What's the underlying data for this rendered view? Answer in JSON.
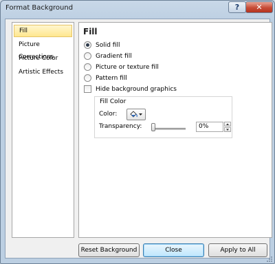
{
  "window": {
    "title": "Format Background"
  },
  "titlebar": {
    "help_label": "?",
    "close_label": "✕"
  },
  "nav": {
    "items": [
      {
        "label": "Fill",
        "selected": true
      },
      {
        "label": "Picture Corrections",
        "selected": false
      },
      {
        "label": "Picture Color",
        "selected": false
      },
      {
        "label": "Artistic Effects",
        "selected": false
      }
    ]
  },
  "panel": {
    "title": "Fill",
    "options": [
      {
        "label": "Solid fill",
        "checked": true
      },
      {
        "label": "Gradient fill",
        "checked": false
      },
      {
        "label": "Picture or texture fill",
        "checked": false
      },
      {
        "label": "Pattern fill",
        "checked": false
      }
    ],
    "hide_graphics": {
      "label": "Hide background graphics",
      "checked": false
    },
    "fill_color": {
      "group_title": "Fill Color",
      "color_label": "Color:",
      "transparency_label": "Transparency:",
      "transparency_value": "0%",
      "transparency_percent": 0,
      "current_color": "#2f6fc6"
    }
  },
  "buttons": {
    "reset": "Reset Background",
    "close": "Close",
    "apply_all": "Apply to All"
  }
}
